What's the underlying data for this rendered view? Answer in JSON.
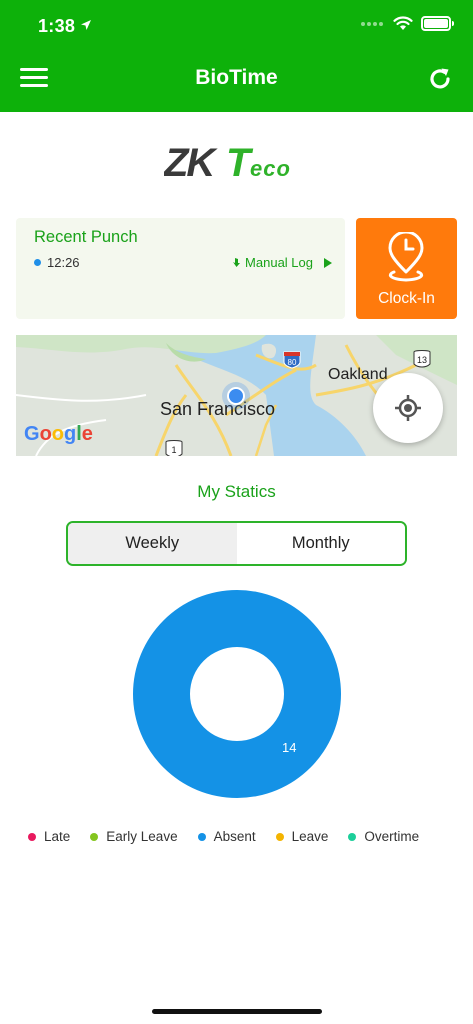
{
  "status_bar": {
    "time": "1:38"
  },
  "nav": {
    "title": "BioTime"
  },
  "logo": {
    "text": "ZKTeco"
  },
  "recent_punch": {
    "title": "Recent Punch",
    "time": "12:26",
    "manual_log_label": "Manual Log"
  },
  "clock_in": {
    "label": "Clock-In"
  },
  "map": {
    "city_label": "San Francisco",
    "oakland_label": "Oakland",
    "highway_80": "80",
    "highway_13": "13",
    "highway_1": "1",
    "attribution": "Google"
  },
  "statics": {
    "title": "My Statics",
    "tabs": [
      "Weekly",
      "Monthly"
    ],
    "selected_tab": "Monthly"
  },
  "chart_data": {
    "type": "pie",
    "donut": true,
    "categories": [
      "Late",
      "Early Leave",
      "Absent",
      "Leave",
      "Overtime"
    ],
    "values": [
      0,
      0,
      14,
      0,
      0
    ],
    "colors": [
      "#e8195e",
      "#84c51f",
      "#1492e6",
      "#f4b400",
      "#1ccf9a"
    ],
    "data_labels": [
      "",
      "",
      "14",
      "",
      ""
    ],
    "legend_placement": "bottom"
  },
  "colors": {
    "primary": "#0db10a",
    "accent_orange": "#ff7a0c",
    "text_green": "#1aa21a"
  }
}
